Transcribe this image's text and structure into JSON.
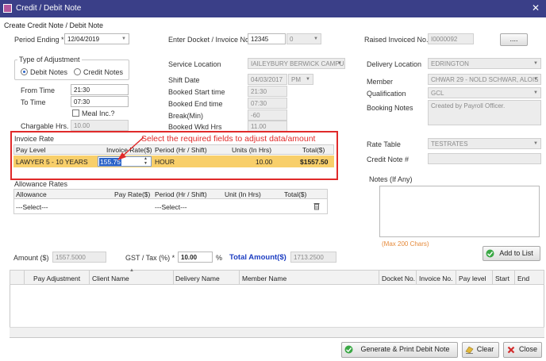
{
  "window": {
    "title": "Credit / Debit Note",
    "subtitle": "Create Credit Note / Debit Note",
    "close": "✕"
  },
  "period_ending": {
    "label": "Period Ending *",
    "value": "12/04/2019"
  },
  "docket": {
    "label": "Enter Docket / Invoice No.",
    "value": "12345",
    "value2": "0"
  },
  "raised_invoice": {
    "label": "Raised Invoiced No.",
    "value": "I0000092",
    "browse_label": "...."
  },
  "adjustment": {
    "title": "Type of Adjustment",
    "debit_label": "Debit Notes",
    "credit_label": "Credit Notes",
    "selected": "Debit Notes"
  },
  "time": {
    "from_label": "From Time",
    "from_value": "21:30",
    "to_label": "To Time",
    "to_value": "07:30",
    "meal_label": "Meal Inc.?",
    "chargeable_label": "Chargable Hrs.",
    "chargeable_value": "10.00"
  },
  "service": {
    "location_label": "Service Location",
    "location_value": "IAILEYBURY BERWICK CAMPUS"
  },
  "shift": {
    "date_label": "Shift Date",
    "date_value": "04/03/2017",
    "ampm": "PM",
    "start_label": "Booked Start time",
    "start_value": "21:30",
    "end_label": "Booked End time",
    "end_value": "07:30",
    "break_label": "Break(Min)",
    "break_value": "-60",
    "wkd_label": "Booked Wkd Hrs",
    "wkd_value": "11.00"
  },
  "delivery": {
    "location_label": "Delivery Location",
    "location_value": "EDRINGTON",
    "member_label": "Member",
    "member_value": "CHWAR 29 - NOLD SCHWAR, ALOIS",
    "qual_label": "Qualification",
    "qual_value": "GCL",
    "notes_label": "Booking Notes",
    "notes_value": "Created by Payroll Officer."
  },
  "invoice_rate": {
    "title": "Invoice Rate",
    "headers": [
      "Pay Level",
      "Invoice Rate($)",
      "Period (Hr / Shift)",
      "Units (In Hrs)",
      "Total($)"
    ],
    "row": {
      "pay_level": "LAWYER 5 - 10 YEARS",
      "rate": "155.75",
      "period": "HOUR",
      "units": "10.00",
      "total": "$1557.50"
    }
  },
  "annotation": "Select the required fields to adjust data/amount",
  "rate_table": {
    "label": "Rate Table",
    "value": "TESTRATES",
    "credit_label": "Credit Note #"
  },
  "allowance": {
    "title": "Allowance Rates",
    "headers": [
      "Allowance",
      "Pay Rate($)",
      "Period (Hr / Shift)",
      "Unit (In Hrs)",
      "Total($)"
    ],
    "select1": "---Select---",
    "select2": "---Select---"
  },
  "notes": {
    "label": "Notes (If Any)",
    "max": "(Max 200  Chars)"
  },
  "amount": {
    "label": "Amount ($)",
    "value": "1557.5000"
  },
  "gst": {
    "label": "GST / Tax (%) *",
    "value": "10.00",
    "pct": "%"
  },
  "total": {
    "label": "Total Amount($)",
    "value": "1713.2500"
  },
  "add_to_list": "Add to List",
  "list": {
    "headers": [
      "Pay Adjustment",
      "Client Name",
      "Delivery Name",
      "Member Name",
      "Docket No.",
      "Invoice No.",
      "Pay level",
      "Start",
      "End"
    ]
  },
  "footer": {
    "generate": "Generate & Print Debit Note",
    "clear": "Clear",
    "close": "Close"
  },
  "colors": {
    "title_bar": "#3a3f88",
    "highlight_row": "#f8cf6a",
    "annotation_red": "#e02a2a",
    "total_blue": "#1d3ec2"
  }
}
